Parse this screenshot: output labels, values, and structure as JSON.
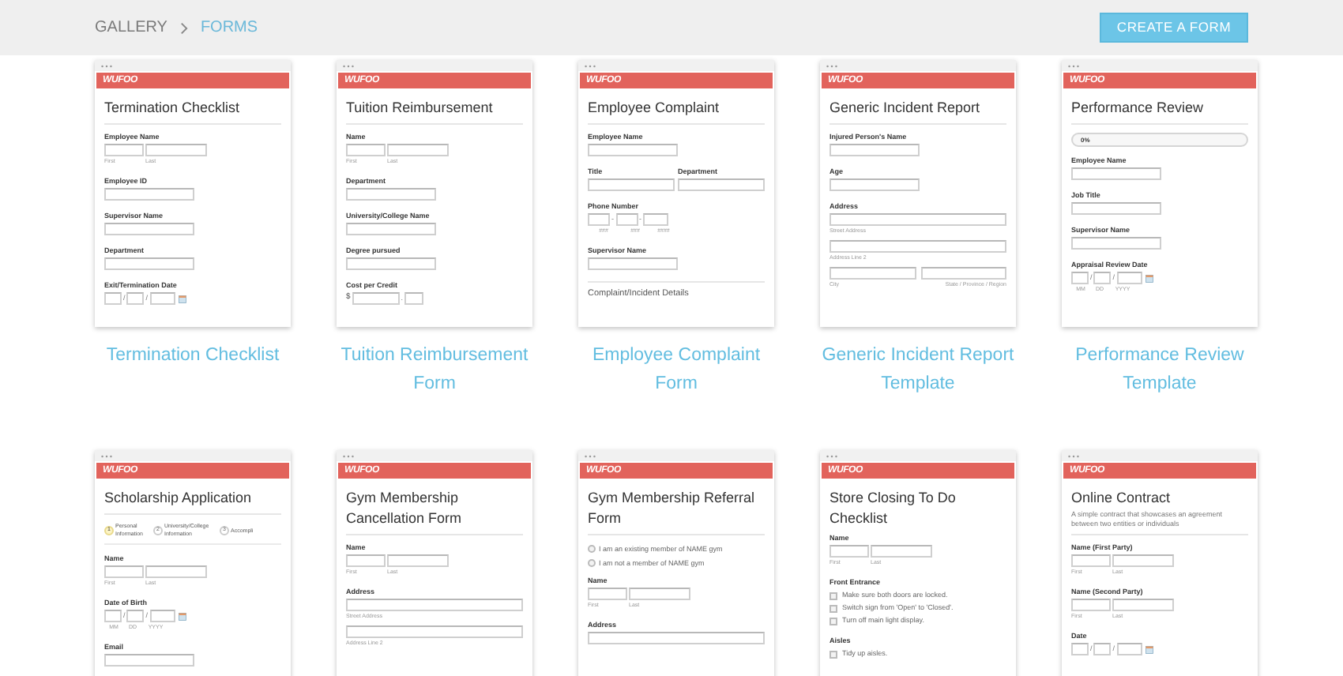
{
  "header": {
    "breadcrumb": [
      {
        "label": "GALLERY",
        "selected": false
      },
      {
        "label": "FORMS",
        "selected": true
      }
    ],
    "create_button": "CREATE A FORM"
  },
  "rows": [
    {
      "templates": [
        {
          "caption": "Termination Checklist",
          "preview": {
            "logo": "WUFOO",
            "title": "Termination Checklist",
            "divider": true,
            "blocks": [
              {
                "kind": "name",
                "label": "Employee Name",
                "sublabels": [
                  "First",
                  "Last"
                ]
              },
              {
                "kind": "text",
                "label": "Employee ID"
              },
              {
                "kind": "text",
                "label": "Supervisor Name"
              },
              {
                "kind": "text",
                "label": "Department"
              },
              {
                "kind": "date",
                "label": "Exit/Termination Date",
                "separator": "/",
                "calendar": true
              }
            ]
          }
        },
        {
          "caption": "Tuition Reimbursement Form",
          "preview": {
            "logo": "WUFOO",
            "title": "Tuition Reimbursement",
            "divider": true,
            "blocks": [
              {
                "kind": "name",
                "label": "Name",
                "sublabels": [
                  "First",
                  "Last"
                ]
              },
              {
                "kind": "text",
                "label": "Department"
              },
              {
                "kind": "text",
                "label": "University/College Name"
              },
              {
                "kind": "text",
                "label": "Degree pursued"
              },
              {
                "kind": "money",
                "label": "Cost per Credit",
                "symbol": "$",
                "separator": "."
              }
            ]
          }
        },
        {
          "caption": "Employee Complaint Form",
          "preview": {
            "logo": "WUFOO",
            "title": "Employee Complaint",
            "divider": true,
            "blocks": [
              {
                "kind": "text",
                "label": "Employee Name"
              },
              {
                "kind": "pair",
                "labels": [
                  "Title",
                  "Department"
                ]
              },
              {
                "kind": "phone",
                "label": "Phone Number",
                "separator": "-",
                "sublabels": [
                  "###",
                  "###",
                  "####"
                ]
              },
              {
                "kind": "text",
                "label": "Supervisor Name"
              },
              {
                "kind": "section",
                "text": "Complaint/Incident Details"
              }
            ]
          }
        },
        {
          "caption": "Generic Incident Report Template",
          "preview": {
            "logo": "WUFOO",
            "title": "Generic Incident Report",
            "divider": true,
            "blocks": [
              {
                "kind": "text",
                "label": "Injured Person's Name"
              },
              {
                "kind": "text",
                "label": "Age"
              },
              {
                "kind": "address",
                "label": "Address",
                "lines": [
                  "Street Address",
                  "Address Line 2"
                ],
                "split": [
                  "City",
                  "State / Province / Region"
                ]
              }
            ]
          }
        },
        {
          "caption": "Performance Review Template",
          "preview": {
            "logo": "WUFOO",
            "title": "Performance Review",
            "divider": true,
            "blocks": [
              {
                "kind": "progress",
                "text": "0%",
                "level": 0
              },
              {
                "kind": "text",
                "label": "Employee Name"
              },
              {
                "kind": "text",
                "label": "Job Title"
              },
              {
                "kind": "text",
                "label": "Supervisor Name"
              },
              {
                "kind": "date",
                "label": "Appraisal Review Date",
                "separator": "/",
                "calendar": true,
                "sublabels": [
                  "MM",
                  "DD",
                  "YYYY"
                ]
              }
            ]
          }
        }
      ]
    },
    {
      "templates": [
        {
          "preview": {
            "logo": "WUFOO",
            "title": "Scholarship Application",
            "divider": true,
            "blocks": [
              {
                "kind": "steps",
                "steps": [
                  {
                    "number": "1",
                    "label": "Personal Information",
                    "selected": true
                  },
                  {
                    "number": "2",
                    "label": "University/College Information",
                    "selected": false
                  },
                  {
                    "number": "3",
                    "label": "Accompli",
                    "selected": false
                  }
                ]
              },
              {
                "kind": "name",
                "label": "Name",
                "sublabels": [
                  "First",
                  "Last"
                ]
              },
              {
                "kind": "date",
                "label": "Date of Birth",
                "separator": "/",
                "calendar": true,
                "sublabels": [
                  "MM",
                  "DD",
                  "YYYY"
                ]
              },
              {
                "kind": "text",
                "label": "Email"
              }
            ]
          }
        },
        {
          "preview": {
            "logo": "WUFOO",
            "title": "Gym Membership Cancellation Form",
            "divider": true,
            "blocks": [
              {
                "kind": "name",
                "label": "Name",
                "sublabels": [
                  "First",
                  "Last"
                ]
              },
              {
                "kind": "address",
                "label": "Address",
                "lines": [
                  "Street Address",
                  "Address Line 2"
                ]
              }
            ]
          }
        },
        {
          "preview": {
            "logo": "WUFOO",
            "title": "Gym Membership Referral Form",
            "divider": true,
            "blocks": [
              {
                "kind": "radio",
                "options": [
                  {
                    "label": "I am an existing member of NAME gym",
                    "selected": false
                  },
                  {
                    "label": "I am not a member of NAME gym",
                    "selected": false
                  }
                ]
              },
              {
                "kind": "name",
                "label": "Name",
                "sublabels": [
                  "First",
                  "Last"
                ]
              },
              {
                "kind": "address",
                "label": "Address"
              }
            ]
          }
        },
        {
          "preview": {
            "logo": "WUFOO",
            "title": "Store Closing To Do Checklist",
            "divider": false,
            "blocks": [
              {
                "kind": "name",
                "label": "Name",
                "sublabels": [
                  "First",
                  "Last"
                ]
              },
              {
                "kind": "checklist",
                "label": "Front Entrance",
                "items": [
                  {
                    "label": "Make sure both doors are locked.",
                    "checked": false
                  },
                  {
                    "label": "Switch sign from 'Open' to 'Closed'.",
                    "checked": false
                  },
                  {
                    "label": "Turn off main light display.",
                    "checked": false
                  }
                ]
              },
              {
                "kind": "checklist",
                "label": "Aisles",
                "items": [
                  {
                    "label": "Tidy up aisles.",
                    "checked": false
                  }
                ]
              }
            ]
          }
        },
        {
          "preview": {
            "logo": "WUFOO",
            "title": "Online Contract",
            "description": "A simple contract that showcases an agreement between two entities or individuals",
            "divider": true,
            "blocks": [
              {
                "kind": "name",
                "label": "Name (First Party)",
                "sublabels": [
                  "First",
                  "Last"
                ]
              },
              {
                "kind": "name",
                "label": "Name (Second Party)",
                "sublabels": [
                  "First",
                  "Last"
                ]
              },
              {
                "kind": "date",
                "label": "Date",
                "separator": "/",
                "calendar": true
              }
            ]
          }
        }
      ]
    }
  ]
}
